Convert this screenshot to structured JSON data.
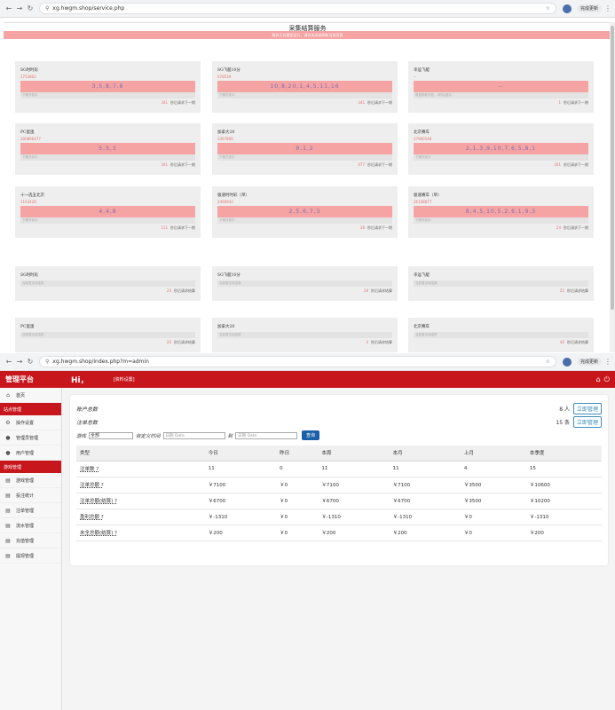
{
  "browser1": {
    "url": "xg.hwgm.shop/service.php",
    "done_label": "完成更新"
  },
  "service": {
    "title": "采集结算服务",
    "notice": "服务正在稳定运行，请勿关闭或刷新当前页面",
    "cards": [
      {
        "name": "SG时时彩",
        "period": "1753802",
        "result": "3,5,8,7,8",
        "sub": "下期开奖中",
        "timer_num": "341",
        "timer_text": "秒后请求下一期"
      },
      {
        "name": "SG飞艇10分",
        "period": "678539",
        "result": "10,8,20,1,4,5,11,16",
        "sub": "下期开奖中",
        "timer_num": "341",
        "timer_text": "秒后请求下一期"
      },
      {
        "name": "幸运飞艇",
        "period": "--",
        "result": "--",
        "sub": "数据获取失败，5秒后重试",
        "timer_num": "1",
        "timer_text": "秒后请求下一期"
      },
      {
        "name": "PC蛋蛋",
        "period": "300896477",
        "result": "5,5,3",
        "sub": "下期开奖中",
        "timer_num": "341",
        "timer_text": "秒后请求下一期"
      },
      {
        "name": "加拿大28",
        "period": "3367806",
        "result": "9,1,2",
        "sub": "下期开奖中",
        "timer_num": "477",
        "timer_text": "秒后请求下一期"
      },
      {
        "name": "北京赛车",
        "period": "27900548",
        "result": "2,1,3,9,10,7,6,5,8,1",
        "sub": "下期开奖中",
        "timer_num": "301",
        "timer_text": "秒后请求下一期"
      },
      {
        "name": "十一选五北京",
        "period": "1163428",
        "result": "4,4,8",
        "sub": "下期开奖中",
        "timer_num": "111",
        "timer_text": "秒后请求下一期"
      },
      {
        "name": "极速时时彩（单）",
        "period": "2460942",
        "result": "2,5,6,7,3",
        "sub": "下期开奖中",
        "timer_num": "28",
        "timer_text": "秒后请求下一期"
      },
      {
        "name": "极速赛车（单）",
        "period": "26108877",
        "result": "8,4,5,10,5,2,6,1,9,3",
        "sub": "下期开奖中",
        "timer_num": "24",
        "timer_text": "秒后请求下一期"
      }
    ],
    "cards2": [
      {
        "name": "SG时时彩",
        "sub": "当前暂无待结算",
        "timer_num": "24",
        "timer_text": "秒后请求结算"
      },
      {
        "name": "SG飞艇10分",
        "sub": "当前暂无待结算",
        "timer_num": "28",
        "timer_text": "秒后请求结算"
      },
      {
        "name": "幸运飞艇",
        "sub": "当前暂无待结算",
        "timer_num": "25",
        "timer_text": "秒后请求结算"
      },
      {
        "name": "PC蛋蛋",
        "sub": "当前暂无待结算",
        "timer_num": "26",
        "timer_text": "秒后请求结算"
      },
      {
        "name": "加拿大28",
        "sub": "当前暂无待结算",
        "timer_num": "4",
        "timer_text": "秒后请求结算"
      },
      {
        "name": "北京赛车",
        "sub": "当前暂无待结算",
        "timer_num": "46",
        "timer_text": "秒后请求结算"
      }
    ]
  },
  "browser2": {
    "url": "xg.hwgm.shop/index.php?m=admin",
    "done_label": "完成更新"
  },
  "admin": {
    "brand": "管理平台",
    "greeting": "Hi，",
    "settings_link": "[资料设置]",
    "sidebar": [
      {
        "type": "item",
        "icon": "home-icon",
        "glyph": "⌂",
        "label": "首页"
      },
      {
        "type": "head",
        "label": "站点管理"
      },
      {
        "type": "item",
        "icon": "gear-icon",
        "glyph": "⚙",
        "label": "操作设置"
      },
      {
        "type": "item",
        "icon": "user-icon",
        "glyph": "●",
        "label": "管理员管理"
      },
      {
        "type": "item",
        "icon": "user-icon",
        "glyph": "●",
        "label": "用户管理"
      },
      {
        "type": "head",
        "label": "游戏管理"
      },
      {
        "type": "item",
        "icon": "doc-icon",
        "glyph": "▤",
        "label": "游戏管理"
      },
      {
        "type": "item",
        "icon": "doc-icon",
        "glyph": "▤",
        "label": "投注统计"
      },
      {
        "type": "item",
        "icon": "doc-icon",
        "glyph": "▤",
        "label": "注单管理"
      },
      {
        "type": "item",
        "icon": "doc-icon",
        "glyph": "▤",
        "label": "流水管理"
      },
      {
        "type": "item",
        "icon": "doc-icon",
        "glyph": "▤",
        "label": "充值管理"
      },
      {
        "type": "item",
        "icon": "doc-icon",
        "glyph": "▤",
        "label": "提现管理"
      }
    ],
    "account_label": "账户总数",
    "account_value": "8 人",
    "account_btn": "立即管理",
    "bet_label": "注单总数",
    "bet_value": "15 条",
    "bet_btn": "立即管理",
    "filter": {
      "game_label": "游戏",
      "game_value": "全部",
      "time_label": "自定义时间",
      "date_placeholder": "日期 Date",
      "to_label": "到",
      "query": "查询"
    },
    "table": {
      "headers": [
        "类型",
        "今日",
        "昨日",
        "本周",
        "本月",
        "上月",
        "本季度"
      ],
      "rows": [
        [
          "注单数 ?",
          "11",
          "0",
          "11",
          "11",
          "4",
          "15"
        ],
        [
          "注单总额 ?",
          "￥7100",
          "￥0",
          "￥7100",
          "￥7100",
          "￥3500",
          "￥10600"
        ],
        [
          "注单总额(结算) ?",
          "￥6700",
          "￥0",
          "￥6700",
          "￥6700",
          "￥3500",
          "￥10200"
        ],
        [
          "盈利总额 ?",
          "￥-1310",
          "￥0",
          "￥-1310",
          "￥-1310",
          "￥0",
          "￥-1310"
        ],
        [
          "未全总额(结算) ?",
          "￥200",
          "￥0",
          "￥200",
          "￥200",
          "￥0",
          "￥200"
        ]
      ]
    }
  }
}
